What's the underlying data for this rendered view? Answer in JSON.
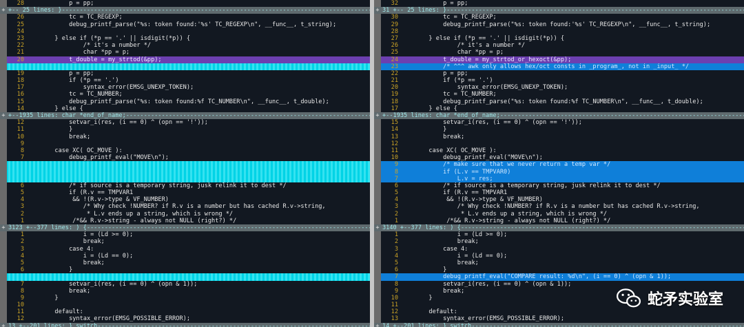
{
  "diff": {
    "left": [
      {
        "t": "normal",
        "ln": "28",
        "code": "            p = pp;"
      },
      {
        "t": "fold",
        "gut": "+",
        "code": "+-- 25 lines: }----------------------------------------------------------------------------------------------"
      },
      {
        "t": "normal",
        "ln": "26",
        "code": "            tc = TC_REGEXP;"
      },
      {
        "t": "normal",
        "ln": "25",
        "code": "            debug_printf_parse(\"%s: token found:'%s' TC_REGEXP\\n\", __func__, t_string);"
      },
      {
        "t": "normal",
        "ln": "24",
        "code": ""
      },
      {
        "t": "normal",
        "ln": "23",
        "code": "        } else if (*p == '.' || isdigit(*p)) {"
      },
      {
        "t": "normal",
        "ln": "22",
        "code": "                /* it's a number */"
      },
      {
        "t": "normal",
        "ln": "21",
        "code": "                char *pp = p;"
      },
      {
        "t": "purple",
        "ln": "20",
        "code": "            t_double = my_strtod(&pp);"
      },
      {
        "t": "filler",
        "ln": "",
        "code": ""
      },
      {
        "t": "normal",
        "ln": "19",
        "code": "            p = pp;"
      },
      {
        "t": "normal",
        "ln": "18",
        "code": "            if (*p == '.')"
      },
      {
        "t": "normal",
        "ln": "17",
        "code": "                syntax_error(EMSG_UNEXP_TOKEN);"
      },
      {
        "t": "normal",
        "ln": "16",
        "code": "            tc = TC_NUMBER;"
      },
      {
        "t": "normal",
        "ln": "15",
        "code": "            debug_printf_parse(\"%s: token found:%f TC_NUMBER\\n\", __func__, t_double);"
      },
      {
        "t": "normal",
        "ln": "14",
        "code": "        } else {"
      },
      {
        "t": "fold",
        "gut": "+",
        "code": "+--1935 lines: char *end_of_name;----------------------------------------------------------------------------"
      },
      {
        "t": "normal",
        "ln": "12",
        "code": "            setvar_i(res, (i == 0) ^ (opn == '!'));"
      },
      {
        "t": "normal",
        "ln": "11",
        "code": "            }"
      },
      {
        "t": "normal",
        "ln": "10",
        "code": "            break;"
      },
      {
        "t": "normal",
        "ln": "9",
        "code": ""
      },
      {
        "t": "normal",
        "ln": "8",
        "code": "        case XC( OC_MOVE ):"
      },
      {
        "t": "normal",
        "ln": "7",
        "code": "            debug_printf_eval(\"MOVE\\n\");"
      },
      {
        "t": "filler",
        "ln": "",
        "code": ""
      },
      {
        "t": "filler",
        "ln": "",
        "code": ""
      },
      {
        "t": "filler",
        "ln": "",
        "code": ""
      },
      {
        "t": "normal",
        "ln": "6",
        "code": "            /* if source is a temporary string, jusk relink it to dest */"
      },
      {
        "t": "normal",
        "ln": "5",
        "code": "            if (R.v == TMPVAR1"
      },
      {
        "t": "normal",
        "ln": "4",
        "code": "             && !(R.v->type & VF_NUMBER)"
      },
      {
        "t": "normal",
        "ln": "3",
        "code": "                /* Why check !NUMBER? if R.v is a number but has cached R.v->string,"
      },
      {
        "t": "normal",
        "ln": "2",
        "code": "                 * L.v ends up a string, which is wrong */"
      },
      {
        "t": "normal",
        "ln": "1",
        "code": "             /*&& R.v->string - always not NULL (right?) */"
      },
      {
        "t": "fold",
        "gut": "+",
        "code": "3123 +--377 lines: ) {---------------------------------------------------------------------------------------"
      },
      {
        "t": "normal",
        "ln": "1",
        "code": "                i = (Ld >= 0);"
      },
      {
        "t": "normal",
        "ln": "2",
        "code": "                break;"
      },
      {
        "t": "normal",
        "ln": "3",
        "code": "            case 4:"
      },
      {
        "t": "normal",
        "ln": "4",
        "code": "                i = (Ld == 0);"
      },
      {
        "t": "normal",
        "ln": "5",
        "code": "                break;"
      },
      {
        "t": "normal",
        "ln": "6",
        "code": "            }"
      },
      {
        "t": "filler",
        "ln": "",
        "code": ""
      },
      {
        "t": "normal",
        "ln": "7",
        "code": "            setvar_i(res, (i == 0) ^ (opn & 1));"
      },
      {
        "t": "normal",
        "ln": "8",
        "code": "            break;"
      },
      {
        "t": "normal",
        "ln": "9",
        "code": "        }"
      },
      {
        "t": "normal",
        "ln": "10",
        "code": ""
      },
      {
        "t": "normal",
        "ln": "11",
        "code": "        default:"
      },
      {
        "t": "normal",
        "ln": "12",
        "code": "            syntax_error(EMSG_POSSIBLE_ERROR);"
      },
      {
        "t": "fold",
        "gut": "+",
        "code": "13 +--201 lines: } switch------------------------------------------------------------------------------------"
      }
    ],
    "right": [
      {
        "t": "normal",
        "ln": "32",
        "code": "            p = pp;"
      },
      {
        "t": "fold",
        "gut": "+",
        "code": "31 +-- 25 lines: }-------------------------------------------------------------------------------------------"
      },
      {
        "t": "normal",
        "ln": "30",
        "code": "            tc = TC_REGEXP;"
      },
      {
        "t": "normal",
        "ln": "29",
        "code": "            debug_printf_parse(\"%s: token found:'%s' TC_REGEXP\\n\", __func__, t_string);"
      },
      {
        "t": "normal",
        "ln": "28",
        "code": ""
      },
      {
        "t": "normal",
        "ln": "27",
        "code": "        } else if (*p == '.' || isdigit(*p)) {"
      },
      {
        "t": "normal",
        "ln": "26",
        "code": "                /* it's a number */"
      },
      {
        "t": "normal",
        "ln": "25",
        "code": "                char *pp = p;"
      },
      {
        "t": "purple",
        "ln": "24",
        "code": "            t_double = my_strtod_or_hexoct(&pp);"
      },
      {
        "t": "blue",
        "ln": "23",
        "code": "            /* ^^^ awk only allows hex/oct consts in _program_, not in _input_ */"
      },
      {
        "t": "normal",
        "ln": "22",
        "code": "            p = pp;"
      },
      {
        "t": "normal",
        "ln": "21",
        "code": "            if (*p == '.')"
      },
      {
        "t": "normal",
        "ln": "20",
        "code": "                syntax_error(EMSG_UNEXP_TOKEN);"
      },
      {
        "t": "normal",
        "ln": "19",
        "code": "            tc = TC_NUMBER;"
      },
      {
        "t": "normal",
        "ln": "18",
        "code": "            debug_printf_parse(\"%s: token found:%f TC_NUMBER\\n\", __func__, t_double);"
      },
      {
        "t": "normal",
        "ln": "17",
        "code": "        } else {"
      },
      {
        "t": "fold",
        "gut": "+",
        "code": "+--1935 lines: char *end_of_name;----------------------------------------------------------------------------"
      },
      {
        "t": "normal",
        "ln": "15",
        "code": "            setvar_i(res, (i == 0) ^ (opn == '!'));"
      },
      {
        "t": "normal",
        "ln": "14",
        "code": "            }"
      },
      {
        "t": "normal",
        "ln": "13",
        "code": "            break;"
      },
      {
        "t": "normal",
        "ln": "12",
        "code": ""
      },
      {
        "t": "normal",
        "ln": "11",
        "code": "        case XC( OC_MOVE ):"
      },
      {
        "t": "normal",
        "ln": "10",
        "code": "            debug_printf_eval(\"MOVE\\n\");"
      },
      {
        "t": "blue",
        "ln": "9",
        "code": "            /* make sure that we never return a temp var */"
      },
      {
        "t": "blue",
        "ln": "8",
        "code": "            if (L.v == TMPVAR0)"
      },
      {
        "t": "blue",
        "ln": "7",
        "code": "                L.v = res;"
      },
      {
        "t": "normal",
        "ln": "6",
        "code": "            /* if source is a temporary string, jusk relink it to dest */"
      },
      {
        "t": "normal",
        "ln": "5",
        "code": "            if (R.v == TMPVAR1"
      },
      {
        "t": "normal",
        "ln": "4",
        "code": "             && !(R.v->type & VF_NUMBER)"
      },
      {
        "t": "normal",
        "ln": "3",
        "code": "                /* Why check !NUMBER? if R.v is a number but has cached R.v->string,"
      },
      {
        "t": "normal",
        "ln": "2",
        "code": "                 * L.v ends up a string, which is wrong */"
      },
      {
        "t": "normal",
        "ln": "1",
        "code": "             /*&& R.v->string - always not NULL (right?) */"
      },
      {
        "t": "fold",
        "gut": "+",
        "code": "3140 +--377 lines: ) {---------------------------------------------------------------------------------------"
      },
      {
        "t": "normal",
        "ln": "1",
        "code": "                i = (Ld >= 0);"
      },
      {
        "t": "normal",
        "ln": "2",
        "code": "                break;"
      },
      {
        "t": "normal",
        "ln": "3",
        "code": "            case 4:"
      },
      {
        "t": "normal",
        "ln": "4",
        "code": "                i = (Ld == 0);"
      },
      {
        "t": "normal",
        "ln": "5",
        "code": "                break;"
      },
      {
        "t": "normal",
        "ln": "6",
        "code": "            }"
      },
      {
        "t": "blue",
        "ln": "7",
        "code": "            debug_printf_eval(\"COMPARE result: %d\\n\", (i == 0) ^ (opn & 1));"
      },
      {
        "t": "normal",
        "ln": "8",
        "code": "            setvar_i(res, (i == 0) ^ (opn & 1));"
      },
      {
        "t": "normal",
        "ln": "9",
        "code": "            break;"
      },
      {
        "t": "normal",
        "ln": "10",
        "code": "        }"
      },
      {
        "t": "normal",
        "ln": "11",
        "code": ""
      },
      {
        "t": "normal",
        "ln": "12",
        "code": "        default:"
      },
      {
        "t": "normal",
        "ln": "13",
        "code": "            syntax_error(EMSG_POSSIBLE_ERROR);"
      },
      {
        "t": "fold",
        "gut": "+",
        "code": "14 +--201 lines: } switch------------------------------------------------------------------------------------"
      }
    ]
  },
  "watermark": {
    "text": "蛇矛实验室",
    "icon": "wechat-icon"
  },
  "colors": {
    "changed": "#6c3fb0",
    "added": "#0f7fd9",
    "filler": "#00d3e6",
    "fold": "#5f6a6e"
  }
}
